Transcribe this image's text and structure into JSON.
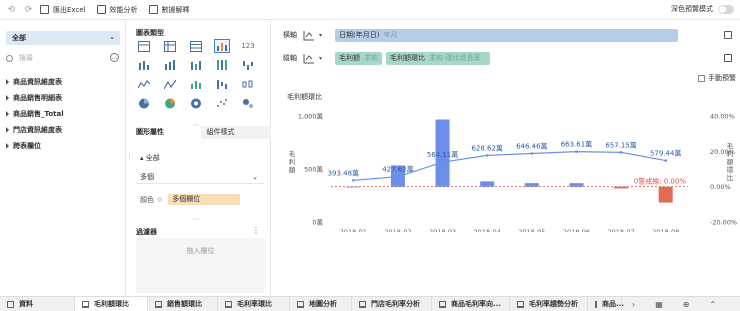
{
  "toolbar": {
    "undo_icon": "undo-icon",
    "redo_icon": "redo-icon",
    "export_excel": "匯出Excel",
    "effect_analysis": "效能分析",
    "data_explain": "數據解釋",
    "dark_mode_label": "深色預覽模式"
  },
  "data_panel": {
    "dataset": "全部",
    "search_placeholder": "搜尋",
    "tables": [
      "商品資訊維度表",
      "商品銷售明細表",
      "商品銷售_Total",
      "門店資訊維度表",
      "跨表欄位"
    ]
  },
  "type_panel": {
    "chart_type_title": "圖表類型",
    "graph_attr_tab": "圖形屬性",
    "component_style_tab": "組件樣式",
    "all_label": "全部",
    "multi_axis": "多個",
    "color_label": "顏色",
    "color_field": "多個欄位",
    "filter_title": "過濾器",
    "filter_drop_hint": "拖入欄位",
    "icon_123": "123"
  },
  "config": {
    "horizontal_label": "橫軸",
    "vertical_label": "縱軸",
    "x_field": "日期(年月日)",
    "x_field_sub": "年月",
    "y_field_1": "毛利額",
    "y_field_1_sub": "求和",
    "y_field_2": "毛利額環比",
    "y_field_2_sub": "求和-環比增長率",
    "manual_warning": "手動預警"
  },
  "chart_data": {
    "type": "bar",
    "title": "毛利額環比",
    "ylabel": "毛利額",
    "y2label": "毛利額環比",
    "y_ticks": [
      "1,000萬",
      "500萬",
      "0萬"
    ],
    "y2_ticks": [
      "40.00%",
      "20.00%",
      "0.00%",
      "-20.00%"
    ],
    "ylim": [
      0,
      1000
    ],
    "y2lim": [
      -20,
      40
    ],
    "categories": [
      "2018-01",
      "2018-02",
      "2018-03",
      "2018-04",
      "2018-05",
      "2018-06",
      "2018-07",
      "2018-08"
    ],
    "series": [
      {
        "name": "毛利額環比",
        "values": [
          0,
          12,
          38,
          3,
          2,
          2,
          -1,
          -9
        ]
      }
    ],
    "line_values": [
      393.48,
      427.62,
      564.11,
      628.62,
      646.46,
      663.61,
      657.15,
      579.44
    ],
    "line_labels": [
      "393.48萬",
      "427.62萬",
      "564.11萬",
      "628.62萬",
      "646.46萬",
      "663.61萬",
      "657.15萬",
      "579.44萬"
    ],
    "warning_label": "0警戒線: 0.00%",
    "colors": {
      "bar": "#6d8fe8",
      "bar_negative": "#e06c55",
      "line": "#6d8fe8",
      "warning": "#e05555"
    }
  },
  "sheets": [
    "資料",
    "毛利額環比",
    "銷售額環比",
    "毛利率環比",
    "地圖分析",
    "門店毛利率分析",
    "商品毛利率向...",
    "毛利率趨勢分析",
    "商品..."
  ]
}
